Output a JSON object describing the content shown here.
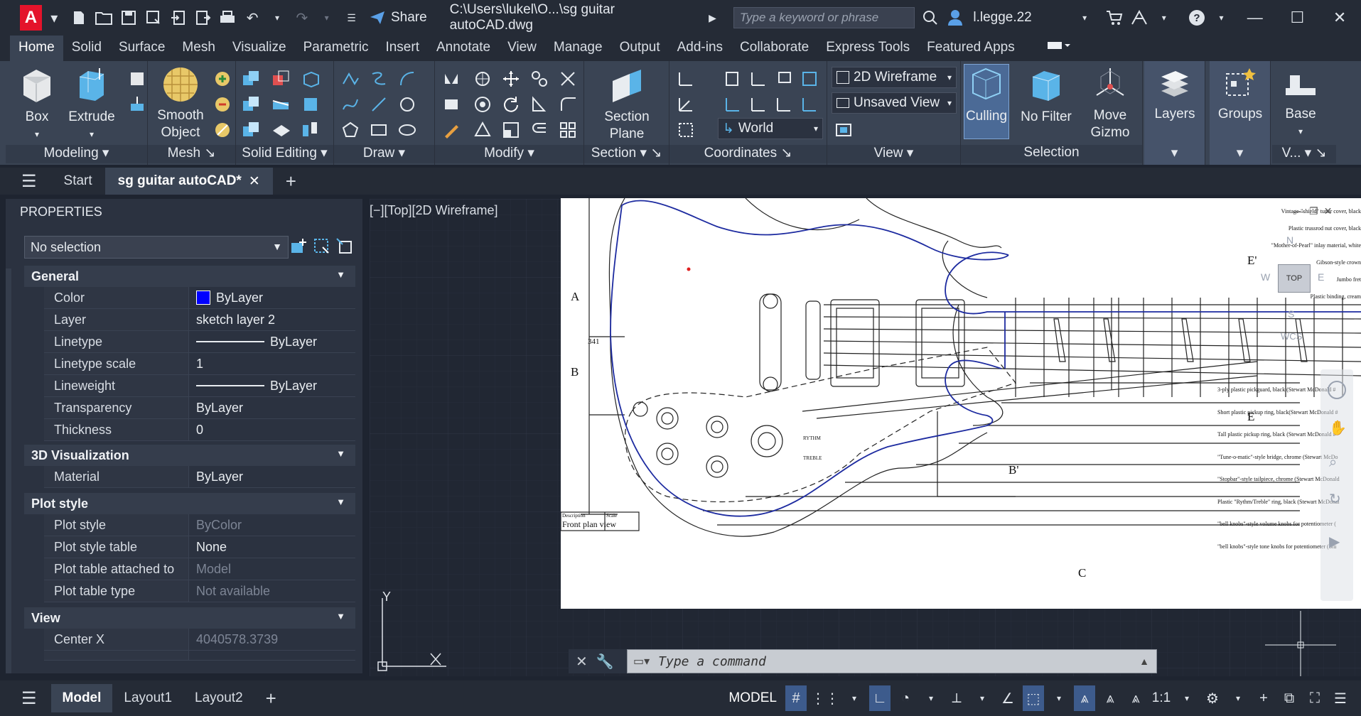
{
  "titlebar": {
    "app_logo": "A",
    "share_label": "Share",
    "file_title": "C:\\Users\\lukel\\O...\\sg guitar autoCAD.dwg",
    "search_placeholder": "Type a keyword or phrase",
    "user_name": "l.legge.22"
  },
  "ribbon_tabs": [
    "Home",
    "Solid",
    "Surface",
    "Mesh",
    "Visualize",
    "Parametric",
    "Insert",
    "Annotate",
    "View",
    "Manage",
    "Output",
    "Add-ins",
    "Collaborate",
    "Express Tools",
    "Featured Apps"
  ],
  "ribbon": {
    "box_label": "Box",
    "extrude_label": "Extrude",
    "smooth_object_label": "Smooth Object",
    "section_plane_label": "Section Plane",
    "visual_style": "2D Wireframe",
    "saved_view": "Unsaved View",
    "ucs": "World",
    "culling_label": "Culling",
    "no_filter_label": "No Filter",
    "move_gizmo_label": "Move Gizmo",
    "layers_label": "Layers",
    "groups_label": "Groups",
    "base_label": "Base",
    "panels": {
      "modeling": "Modeling",
      "mesh": "Mesh",
      "solid_editing": "Solid Editing",
      "draw": "Draw",
      "modify": "Modify",
      "section": "Section",
      "coordinates": "Coordinates",
      "view": "View",
      "selection": "Selection",
      "v": "V..."
    }
  },
  "file_tabs": {
    "start": "Start",
    "active": "sg guitar autoCAD*"
  },
  "properties": {
    "header": "PROPERTIES",
    "selection": "No selection",
    "general_title": "General",
    "visualization_title": "3D Visualization",
    "plotstyle_title": "Plot style",
    "view_title": "View",
    "general": [
      {
        "name": "Color",
        "value": "ByLayer"
      },
      {
        "name": "Layer",
        "value": "sketch layer 2"
      },
      {
        "name": "Linetype",
        "value": "ByLayer"
      },
      {
        "name": "Linetype scale",
        "value": "1"
      },
      {
        "name": "Lineweight",
        "value": "ByLayer"
      },
      {
        "name": "Transparency",
        "value": "ByLayer"
      },
      {
        "name": "Thickness",
        "value": "0"
      }
    ],
    "visualization": [
      {
        "name": "Material",
        "value": "ByLayer"
      }
    ],
    "plotstyle": [
      {
        "name": "Plot style",
        "value": "ByColor"
      },
      {
        "name": "Plot style table",
        "value": "None"
      },
      {
        "name": "Plot table attached to",
        "value": "Model"
      },
      {
        "name": "Plot table type",
        "value": "Not available"
      }
    ],
    "view": [
      {
        "name": "Center X",
        "value": "4040578.3739"
      }
    ]
  },
  "viewport": {
    "label": "[−][Top][2D Wireframe]",
    "viewcube_top": "TOP",
    "viewcube_n": "N",
    "viewcube_s": "S",
    "viewcube_e": "E",
    "viewcube_w": "W",
    "wcs": "WCS"
  },
  "drawing": {
    "label_a": "A",
    "label_b": "B",
    "label_c": "C",
    "label_b2": "B'",
    "label_e1": "E'",
    "label_e2": "E",
    "dimension": "341",
    "title_desc": "Description",
    "title_scale": "Scale",
    "title_text": "Front plan view",
    "pickup_label1": "RYTHM",
    "pickup_label2": "TREBLE",
    "notes_top": [
      "Vintage-\"shield\" tuner cover, black",
      "Plastic trussrod nut cover, black",
      "\"Mother-of-Pearl\" inlay material, white",
      "Gibson-style crown",
      "Jumbo fret",
      "Plastic binding, cream"
    ],
    "notes": [
      "3-ply plastic pickguard, black (Stewart McDonald #",
      "Short plastic pickup ring, black(Stewart McDonald #",
      "Tall plastic pickup ring, black (Stewart McDonald #",
      "\"Tune-o-matic\"-style bridge, chrome (Stewart McDo",
      "\"Stopbar\"-style tailpiece, chrome (Stewart McDonald",
      "Plastic \"Rythm/Treble\" ring, black (Stewart McDonal",
      "\"bell knobs\"-style volume knobs for potentiometer (",
      "\"bell knobs\"-style tone knobs for potentiometer (Stu"
    ]
  },
  "ucs_icon": {
    "y": "Y"
  },
  "command": {
    "placeholder": "Type a command"
  },
  "layout_tabs": [
    "Model",
    "Layout1",
    "Layout2"
  ],
  "status": {
    "model": "MODEL",
    "scale": "1:1"
  },
  "colors": {
    "accent": "#3d5b8c",
    "blue_swatch": "#0000ff",
    "outline_blue": "#1d2ba0"
  }
}
